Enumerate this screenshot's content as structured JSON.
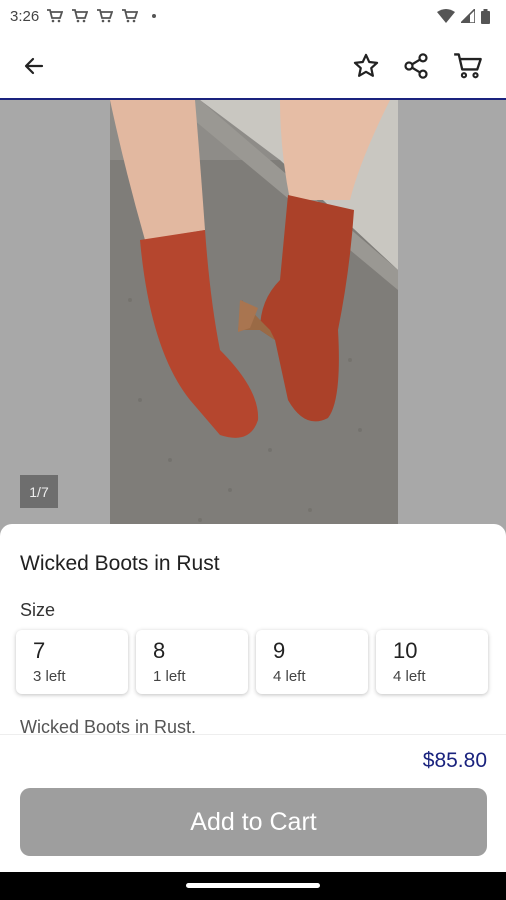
{
  "status": {
    "time": "3:26",
    "notification_icons": [
      "cart-icon",
      "cart-icon",
      "cart-icon",
      "cart-icon"
    ]
  },
  "app_bar": {
    "icons": [
      "back-arrow-icon",
      "star-icon",
      "share-icon",
      "cart-icon"
    ]
  },
  "gallery": {
    "counter": "1/7"
  },
  "product": {
    "title": "Wicked Boots in Rust",
    "size_label": "Size",
    "sizes": [
      {
        "size": "7",
        "stock": "3 left"
      },
      {
        "size": "8",
        "stock": "1 left"
      },
      {
        "size": "9",
        "stock": "4 left"
      },
      {
        "size": "10",
        "stock": "4 left"
      }
    ],
    "description": "Wicked Boots in Rust."
  },
  "checkout": {
    "price": "$85.80",
    "add_to_cart_label": "Add to Cart"
  },
  "colors": {
    "accent": "#1a237e",
    "button_disabled": "#9e9e9e",
    "boot": "#b5462e"
  }
}
